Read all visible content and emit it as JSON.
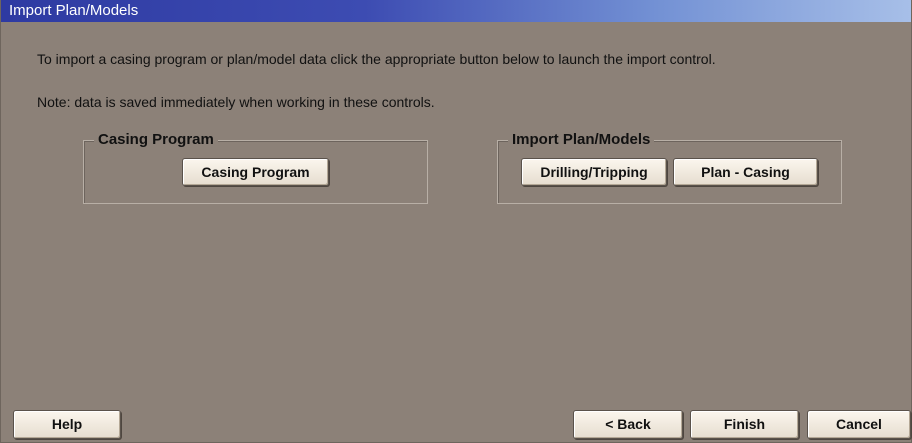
{
  "window": {
    "title": "Import Plan/Models"
  },
  "content": {
    "intro_text": "To import a casing program or plan/model data click the appropriate button below to launch the import control.",
    "note_text": "Note: data is saved immediately when working in these controls."
  },
  "casing_group": {
    "legend": "Casing Program",
    "button_label": "Casing Program"
  },
  "import_group": {
    "legend": "Import Plan/Models",
    "drilling_button_label": "Drilling/Tripping",
    "plan_casing_button_label": "Plan - Casing"
  },
  "footer": {
    "help_label": "Help",
    "back_label": "< Back",
    "finish_label": "Finish",
    "cancel_label": "Cancel"
  },
  "colors": {
    "background": "#8c8178",
    "titlebar_start": "#2e3aa2",
    "titlebar_end": "#a7bfe8",
    "button_face": "#f3ede3"
  }
}
